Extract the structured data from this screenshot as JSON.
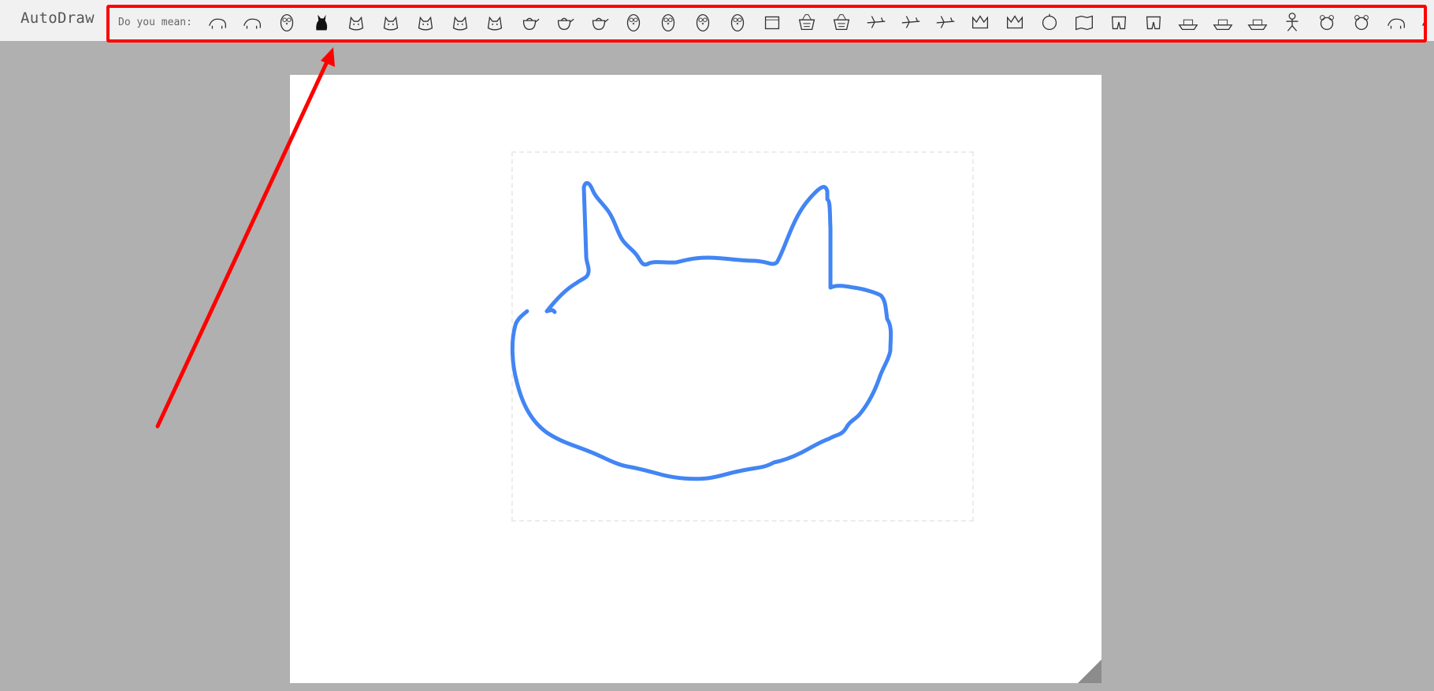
{
  "app": {
    "title": "AutoDraw"
  },
  "suggestions": {
    "label": "Do you mean:",
    "items": [
      {
        "name": "hedgehog-icon"
      },
      {
        "name": "horse-icon"
      },
      {
        "name": "owl-icon"
      },
      {
        "name": "black-cat-icon"
      },
      {
        "name": "cat-face-icon"
      },
      {
        "name": "cat-icon"
      },
      {
        "name": "cat-walking-icon"
      },
      {
        "name": "cat-head-icon"
      },
      {
        "name": "cat-sitting-icon"
      },
      {
        "name": "teapot-icon"
      },
      {
        "name": "coffee-pot-icon"
      },
      {
        "name": "kettle-icon"
      },
      {
        "name": "owl-standing-icon"
      },
      {
        "name": "owl-small-icon"
      },
      {
        "name": "owl-face-icon"
      },
      {
        "name": "owl-perched-icon"
      },
      {
        "name": "box-icon"
      },
      {
        "name": "basket-icon"
      },
      {
        "name": "woven-basket-icon"
      },
      {
        "name": "ufo-icon"
      },
      {
        "name": "jet-icon"
      },
      {
        "name": "airplane-icon"
      },
      {
        "name": "crown-icon"
      },
      {
        "name": "ornate-crown-icon"
      },
      {
        "name": "pumpkin-icon"
      },
      {
        "name": "map-icon"
      },
      {
        "name": "underwear-icon"
      },
      {
        "name": "shorts-icon"
      },
      {
        "name": "ship-icon"
      },
      {
        "name": "cruise-ship-icon"
      },
      {
        "name": "boat-icon"
      },
      {
        "name": "gingerbread-man-icon"
      },
      {
        "name": "teddy-bear-icon"
      },
      {
        "name": "teddy-bear-sitting-icon"
      },
      {
        "name": "polar-bear-icon"
      },
      {
        "name": "bear-icon"
      }
    ]
  },
  "colors": {
    "stroke": "#4285f4",
    "annotation": "#ff0000",
    "background": "#b0b0b0",
    "paper": "#ffffff"
  }
}
